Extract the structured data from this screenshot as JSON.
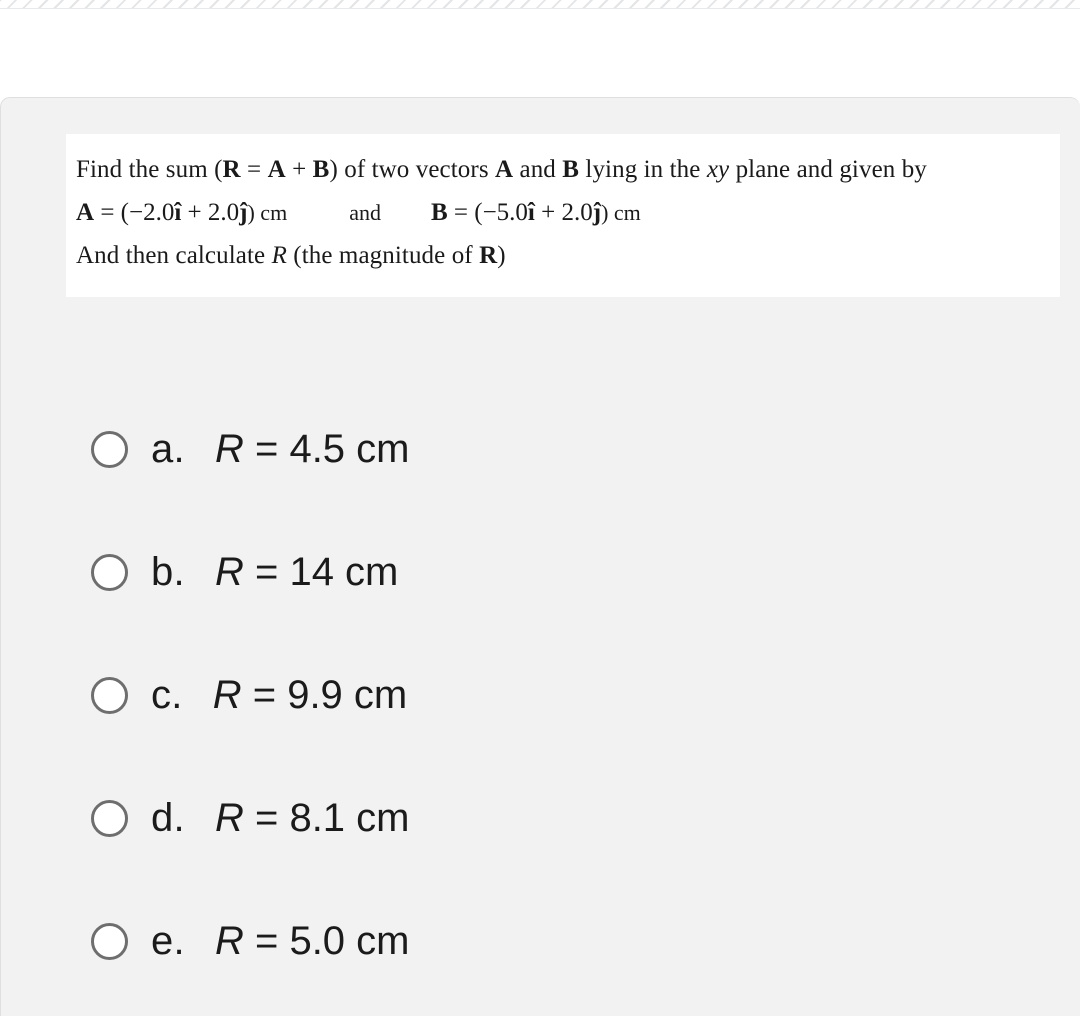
{
  "page": {
    "background_color": "#ffffff",
    "card_background_color": "#f2f2f2",
    "statement_background_color": "#ffffff",
    "radio_border_color": "#6e6e6e",
    "text_color": "#1b1b1b"
  },
  "question": {
    "line1": {
      "seg1": "Find the sum (",
      "seg2": "R",
      "seg3": " = ",
      "seg4": "A",
      "seg5": " + ",
      "seg6": "B",
      "seg7": ") of two vectors ",
      "seg8": "A",
      "seg9": " and ",
      "seg10": "B",
      "seg11": " lying in the ",
      "seg12": "xy",
      "seg13": " plane and given by"
    },
    "line2": {
      "a_label": "A",
      "a_eq": " = (−2.0",
      "a_ihat": "î",
      "a_plus": " + 2.0",
      "a_jhat": "ĵ",
      "a_unit": ") cm",
      "and": "and",
      "b_label": "B",
      "b_eq": " = (−5.0",
      "b_ihat": "î",
      "b_plus": " + 2.0",
      "b_jhat": "ĵ",
      "b_unit": ") cm"
    },
    "line3": {
      "seg1": "And then calculate ",
      "seg2": "R",
      "seg3": " (the magnitude of ",
      "seg4": "R",
      "seg5": ")"
    }
  },
  "options": [
    {
      "letter": "a.",
      "symbol": "R",
      "rest": " = 4.5 cm",
      "selected": false
    },
    {
      "letter": "b.",
      "symbol": "R",
      "rest": " = 14 cm",
      "selected": false
    },
    {
      "letter": "c.",
      "symbol": "R",
      "rest": " = 9.9 cm",
      "selected": false
    },
    {
      "letter": "d.",
      "symbol": "R",
      "rest": " = 8.1 cm",
      "selected": false
    },
    {
      "letter": "e.",
      "symbol": "R",
      "rest": " = 5.0 cm",
      "selected": false
    }
  ]
}
